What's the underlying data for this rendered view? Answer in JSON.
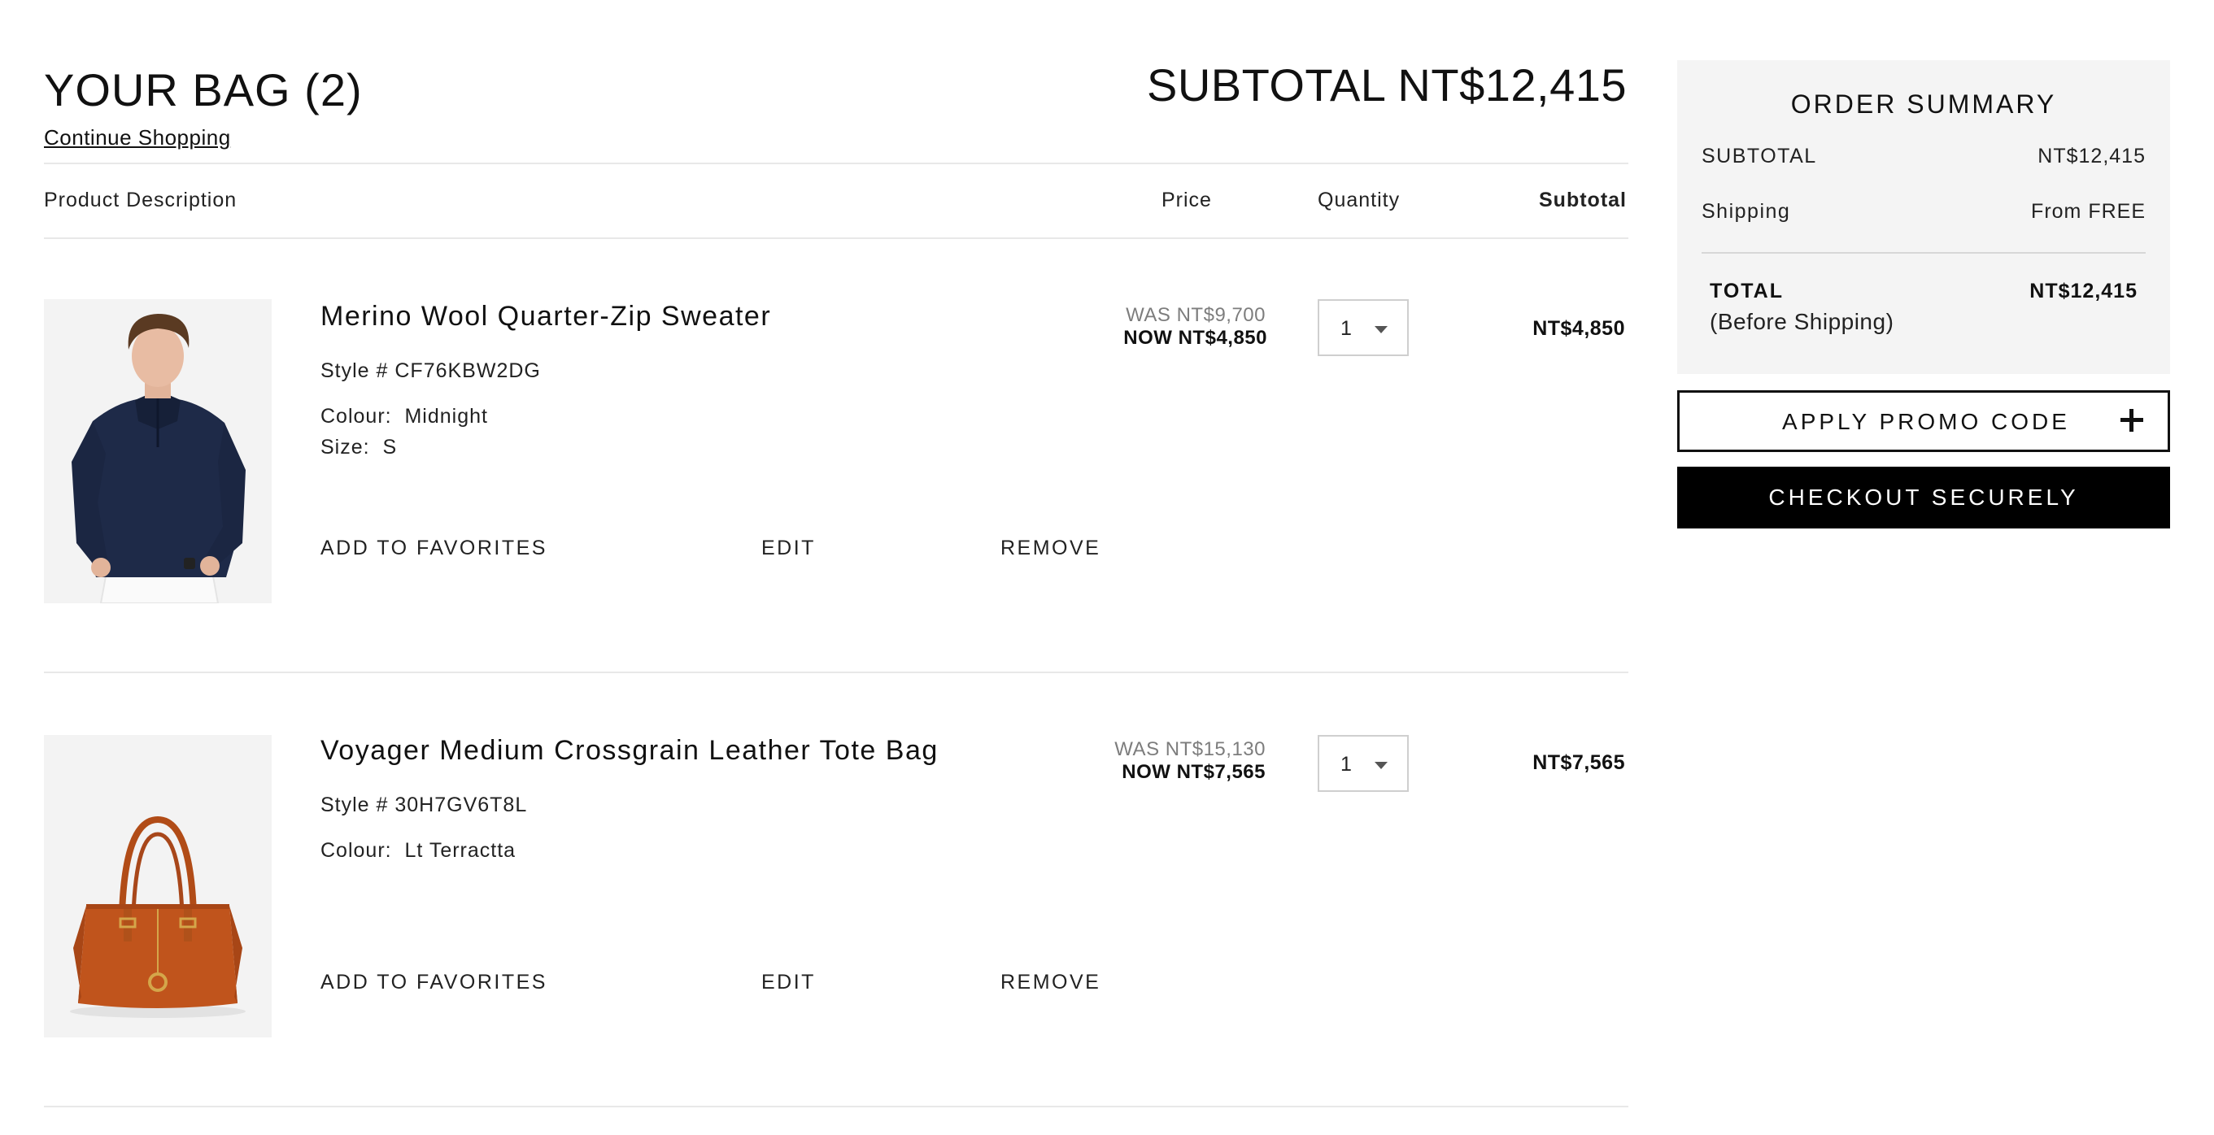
{
  "header": {
    "title": "YOUR BAG (2)",
    "continue_shopping": "Continue Shopping",
    "subtotal": "SUBTOTAL NT$12,415"
  },
  "columns": {
    "description": "Product Description",
    "price": "Price",
    "quantity": "Quantity",
    "subtotal": "Subtotal"
  },
  "items": [
    {
      "name": "Merino Wool Quarter-Zip Sweater",
      "style": "Style # CF76KBW2DG",
      "colour": "Colour:  Midnight",
      "size": "Size:  S",
      "was_price": "WAS NT$9,700",
      "now_price": "NOW NT$4,850",
      "quantity": "1",
      "subtotal": "NT$4,850",
      "actions": {
        "favorites": "ADD TO FAVORITES",
        "edit": "EDIT",
        "remove": "REMOVE"
      },
      "colors": {
        "garment": "#1e2a48"
      }
    },
    {
      "name": "Voyager Medium Crossgrain Leather Tote Bag",
      "style": "Style # 30H7GV6T8L",
      "colour": "Colour:  Lt Terractta",
      "was_price": "WAS NT$15,130",
      "now_price": "NOW NT$7,565",
      "quantity": "1",
      "subtotal": "NT$7,565",
      "actions": {
        "favorites": "ADD TO FAVORITES",
        "edit": "EDIT",
        "remove": "REMOVE"
      },
      "colors": {
        "bag": "#c0541c"
      }
    }
  ],
  "summary": {
    "title": "ORDER SUMMARY",
    "subtotal_label": "SUBTOTAL",
    "subtotal_value": "NT$12,415",
    "shipping_label": "Shipping",
    "shipping_value": "From FREE",
    "total_label": "TOTAL",
    "total_note": "(Before Shipping)",
    "total_value": "NT$12,415",
    "promo_label": "APPLY PROMO CODE",
    "checkout_label": "CHECKOUT SECURELY"
  }
}
